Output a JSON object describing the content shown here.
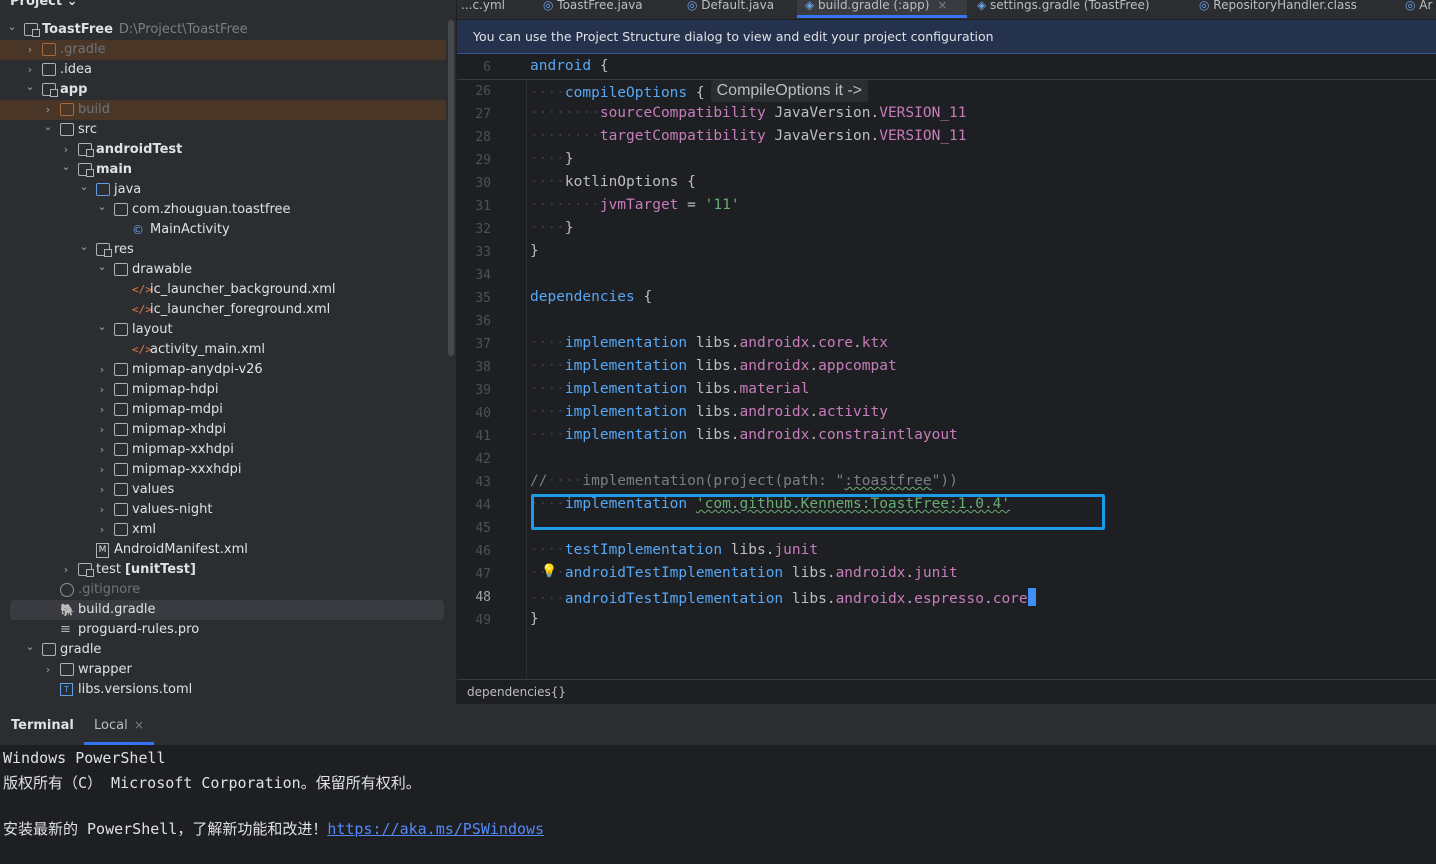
{
  "project_panel": {
    "title": "Project ⌄",
    "tree": [
      {
        "label": "ToastFree",
        "path": "D:\\Project\\ToastFree",
        "level": 0,
        "chevron": "⌄",
        "icon": "module-folder",
        "bold": true
      },
      {
        "label": ".gradle",
        "level": 1,
        "chevron": "›",
        "icon": "folder-excluded",
        "excluded": true
      },
      {
        "label": ".idea",
        "level": 1,
        "chevron": "›",
        "icon": "folder"
      },
      {
        "label": "app",
        "level": 1,
        "chevron": "⌄",
        "icon": "module-folder",
        "bold": true
      },
      {
        "label": "build",
        "level": 2,
        "chevron": "›",
        "icon": "folder-excluded",
        "excluded": true
      },
      {
        "label": "src",
        "level": 2,
        "chevron": "⌄",
        "icon": "folder"
      },
      {
        "label": "androidTest",
        "level": 3,
        "chevron": "›",
        "icon": "module-folder",
        "bold": true
      },
      {
        "label": "main",
        "level": 3,
        "chevron": "⌄",
        "icon": "module-folder",
        "bold": true
      },
      {
        "label": "java",
        "level": 4,
        "chevron": "⌄",
        "icon": "source-folder"
      },
      {
        "label": "com.zhouguan.toastfree",
        "level": 5,
        "chevron": "⌄",
        "icon": "package"
      },
      {
        "label": "MainActivity",
        "level": 6,
        "chevron": "",
        "icon": "class"
      },
      {
        "label": "res",
        "level": 4,
        "chevron": "⌄",
        "icon": "resource-folder"
      },
      {
        "label": "drawable",
        "level": 5,
        "chevron": "⌄",
        "icon": "folder"
      },
      {
        "label": "ic_launcher_background.xml",
        "level": 6,
        "chevron": "",
        "icon": "xml"
      },
      {
        "label": "ic_launcher_foreground.xml",
        "level": 6,
        "chevron": "",
        "icon": "xml"
      },
      {
        "label": "layout",
        "level": 5,
        "chevron": "⌄",
        "icon": "folder"
      },
      {
        "label": "activity_main.xml",
        "level": 6,
        "chevron": "",
        "icon": "xml"
      },
      {
        "label": "mipmap-anydpi-v26",
        "level": 5,
        "chevron": "›",
        "icon": "folder"
      },
      {
        "label": "mipmap-hdpi",
        "level": 5,
        "chevron": "›",
        "icon": "folder"
      },
      {
        "label": "mipmap-mdpi",
        "level": 5,
        "chevron": "›",
        "icon": "folder"
      },
      {
        "label": "mipmap-xhdpi",
        "level": 5,
        "chevron": "›",
        "icon": "folder"
      },
      {
        "label": "mipmap-xxhdpi",
        "level": 5,
        "chevron": "›",
        "icon": "folder"
      },
      {
        "label": "mipmap-xxxhdpi",
        "level": 5,
        "chevron": "›",
        "icon": "folder"
      },
      {
        "label": "values",
        "level": 5,
        "chevron": "›",
        "icon": "folder"
      },
      {
        "label": "values-night",
        "level": 5,
        "chevron": "›",
        "icon": "folder"
      },
      {
        "label": "xml",
        "level": 5,
        "chevron": "›",
        "icon": "folder"
      },
      {
        "label": "AndroidManifest.xml",
        "level": 4,
        "chevron": "",
        "icon": "manifest"
      },
      {
        "label": "test",
        "suffix": "[unitTest]",
        "level": 3,
        "chevron": "›",
        "icon": "module-folder"
      },
      {
        "label": ".gitignore",
        "level": 2,
        "chevron": "",
        "icon": "ignore",
        "dim": true
      },
      {
        "label": "build.gradle",
        "level": 2,
        "chevron": "",
        "icon": "gradle",
        "selected": true
      },
      {
        "label": "proguard-rules.pro",
        "level": 2,
        "chevron": "",
        "icon": "text"
      },
      {
        "label": "gradle",
        "level": 1,
        "chevron": "⌄",
        "icon": "folder"
      },
      {
        "label": "wrapper",
        "level": 2,
        "chevron": "›",
        "icon": "folder"
      },
      {
        "label": "libs.versions.toml",
        "level": 2,
        "chevron": "",
        "icon": "toml"
      }
    ]
  },
  "editor_tabs": [
    {
      "label": "...c.yml",
      "icon": ""
    },
    {
      "label": "ToastFree.java",
      "icon": "class-icon"
    },
    {
      "label": "Default.java",
      "icon": "class-icon"
    },
    {
      "label": "build.gradle (:app)",
      "icon": "gradle-icon",
      "active": true,
      "close": "×"
    },
    {
      "label": "settings.gradle (ToastFree)",
      "icon": "gradle-icon"
    },
    {
      "label": "RepositoryHandler.class",
      "icon": "class-icon"
    },
    {
      "label": "Ar",
      "icon": "class-icon"
    }
  ],
  "notification": {
    "text": "You can use the Project Structure dialog to view and edit your project configuration"
  },
  "editor": {
    "current_line": 48,
    "inlay_hint": "CompileOptions it ->",
    "lines": [
      {
        "n": 6,
        "code": "android {"
      },
      {
        "n": 26,
        "code": "····compileOptions {"
      },
      {
        "n": 27,
        "code": "········sourceCompatibility JavaVersion.VERSION_11"
      },
      {
        "n": 28,
        "code": "········targetCompatibility JavaVersion.VERSION_11"
      },
      {
        "n": 29,
        "code": "····}"
      },
      {
        "n": 30,
        "code": "····kotlinOptions {"
      },
      {
        "n": 31,
        "code": "········jvmTarget = '11'"
      },
      {
        "n": 32,
        "code": "····}"
      },
      {
        "n": 33,
        "code": "}"
      },
      {
        "n": 34,
        "code": ""
      },
      {
        "n": 35,
        "code": "dependencies {"
      },
      {
        "n": 36,
        "code": ""
      },
      {
        "n": 37,
        "code": "····implementation libs.androidx.core.ktx"
      },
      {
        "n": 38,
        "code": "····implementation libs.androidx.appcompat"
      },
      {
        "n": 39,
        "code": "····implementation libs.material"
      },
      {
        "n": 40,
        "code": "····implementation libs.androidx.activity"
      },
      {
        "n": 41,
        "code": "····implementation libs.androidx.constraintlayout"
      },
      {
        "n": 42,
        "code": ""
      },
      {
        "n": 43,
        "code": "//····implementation(project(path: \":toastfree\"))"
      },
      {
        "n": 44,
        "code": "····implementation 'com.github.Kennems:ToastFree:1.0.4'"
      },
      {
        "n": 45,
        "code": ""
      },
      {
        "n": 46,
        "code": "····testImplementation libs.junit"
      },
      {
        "n": 47,
        "code": "····androidTestImplementation libs.androidx.junit"
      },
      {
        "n": 48,
        "code": "····androidTestImplementation libs.androidx.espresso.core"
      },
      {
        "n": 49,
        "code": "}"
      }
    ]
  },
  "breadcrumb": {
    "text": "dependencies{}"
  },
  "terminal": {
    "title": "Terminal",
    "tab_label": "Local",
    "tab_close": "×",
    "lines": [
      "Windows PowerShell",
      "版权所有（C） Microsoft Corporation。保留所有权利。",
      "",
      "安装最新的 PowerShell，了解新功能和改进！"
    ],
    "link": "https://aka.ms/PSWindows"
  },
  "colors": {
    "keyword": "#56a8f5",
    "property": "#c77dbb",
    "string": "#6aab73",
    "comment": "#7a7e85",
    "highlight_box": "#1e9be6",
    "accent": "#3574f0"
  }
}
